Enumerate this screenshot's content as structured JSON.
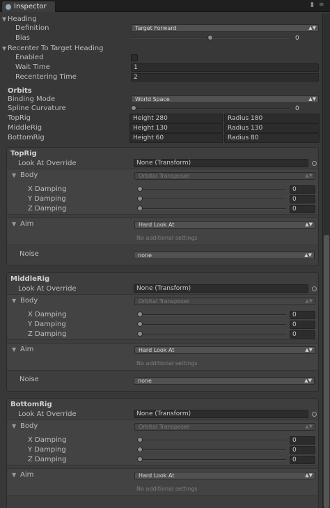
{
  "tab": {
    "title": "Inspector",
    "icon": "info-icon"
  },
  "heading": {
    "label": "Heading",
    "definition": {
      "label": "Definition",
      "value": "Target Forward"
    },
    "bias": {
      "label": "Bias",
      "value": "0",
      "slider": 0.5
    }
  },
  "recenter": {
    "label": "Recenter To Target Heading",
    "enabled": {
      "label": "Enabled",
      "checked": false
    },
    "wait_time": {
      "label": "Wait Time",
      "value": "1"
    },
    "recentering_time": {
      "label": "Recentering Time",
      "value": "2"
    }
  },
  "orbits": {
    "label": "Orbits",
    "binding_mode": {
      "label": "Binding Mode",
      "value": "World Space"
    },
    "spline_curvature": {
      "label": "Spline Curvature",
      "value": "0",
      "slider": 0.0
    },
    "rows": [
      {
        "label": "TopRig",
        "height": "Height 280",
        "radius": "Radius 180"
      },
      {
        "label": "MiddleRig",
        "height": "Height 130",
        "radius": "Radius 130"
      },
      {
        "label": "BottomRig",
        "height": "Height 60",
        "radius": "Radius 80"
      }
    ]
  },
  "rigs": [
    {
      "title": "TopRig",
      "look_at_label": "Look At Override",
      "look_at_value": "None (Transform)",
      "body_label": "Body",
      "body_value": "Orbital Transposer",
      "dampings": [
        {
          "label": "X Damping",
          "value": "0",
          "slider": 0.0
        },
        {
          "label": "Y Damping",
          "value": "0",
          "slider": 0.0
        },
        {
          "label": "Z Damping",
          "value": "0",
          "slider": 0.0
        }
      ],
      "aim_label": "Aim",
      "aim_value": "Hard Look At",
      "no_settings": "No additional settings",
      "noise_label": "Noise",
      "noise_value": "none"
    },
    {
      "title": "MiddleRig",
      "look_at_label": "Look At Override",
      "look_at_value": "None (Transform)",
      "body_label": "Body",
      "body_value": "Orbital Transposer",
      "dampings": [
        {
          "label": "X Damping",
          "value": "0",
          "slider": 0.0
        },
        {
          "label": "Y Damping",
          "value": "0",
          "slider": 0.0
        },
        {
          "label": "Z Damping",
          "value": "0",
          "slider": 0.0
        }
      ],
      "aim_label": "Aim",
      "aim_value": "Hard Look At",
      "no_settings": "No additional settings",
      "noise_label": "Noise",
      "noise_value": "none"
    },
    {
      "title": "BottomRig",
      "look_at_label": "Look At Override",
      "look_at_value": "None (Transform)",
      "body_label": "Body",
      "body_value": "Orbital Transposer",
      "dampings": [
        {
          "label": "X Damping",
          "value": "0",
          "slider": 0.0
        },
        {
          "label": "Y Damping",
          "value": "0",
          "slider": 0.0
        },
        {
          "label": "Z Damping",
          "value": "0",
          "slider": 0.0
        }
      ],
      "aim_label": "Aim",
      "aim_value": "Hard Look At",
      "no_settings": "No additional settings"
    }
  ],
  "icons": {
    "dropdown": "▾",
    "foldout_open": "▼",
    "lock": "lock-icon",
    "menu": "menu-icon",
    "picker": "object-picker-icon"
  },
  "colors": {
    "background": "#383838",
    "panel": "#3e3e3e",
    "field": "#2c2c2c",
    "text": "#bdbdbd"
  }
}
